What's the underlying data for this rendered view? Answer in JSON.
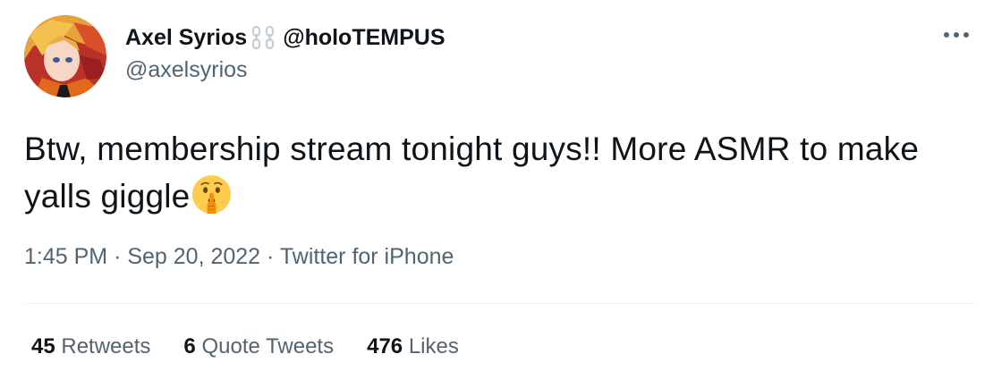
{
  "author": {
    "display_name": "Axel Syrios",
    "affiliation": "@holoTEMPUS",
    "handle": "@axelsyrios",
    "avatar_icon": "avatar-image",
    "badge_icon": "chain-link-icon"
  },
  "tweet": {
    "text": "Btw, membership stream tonight guys!! More ASMR to make yalls giggle",
    "emoji_icon": "shushing-face-emoji"
  },
  "meta": {
    "time": "1:45 PM",
    "separator": "·",
    "date": "Sep 20, 2022",
    "source": "Twitter for iPhone"
  },
  "stats": {
    "retweets_count": "45",
    "retweets_label": "Retweets",
    "quote_tweets_count": "6",
    "quote_tweets_label": "Quote Tweets",
    "likes_count": "476",
    "likes_label": "Likes"
  },
  "colors": {
    "text_primary": "#0f1419",
    "text_secondary": "#536471",
    "divider": "#eff3f4",
    "badge": "#c5cdd3",
    "background": "#ffffff"
  }
}
